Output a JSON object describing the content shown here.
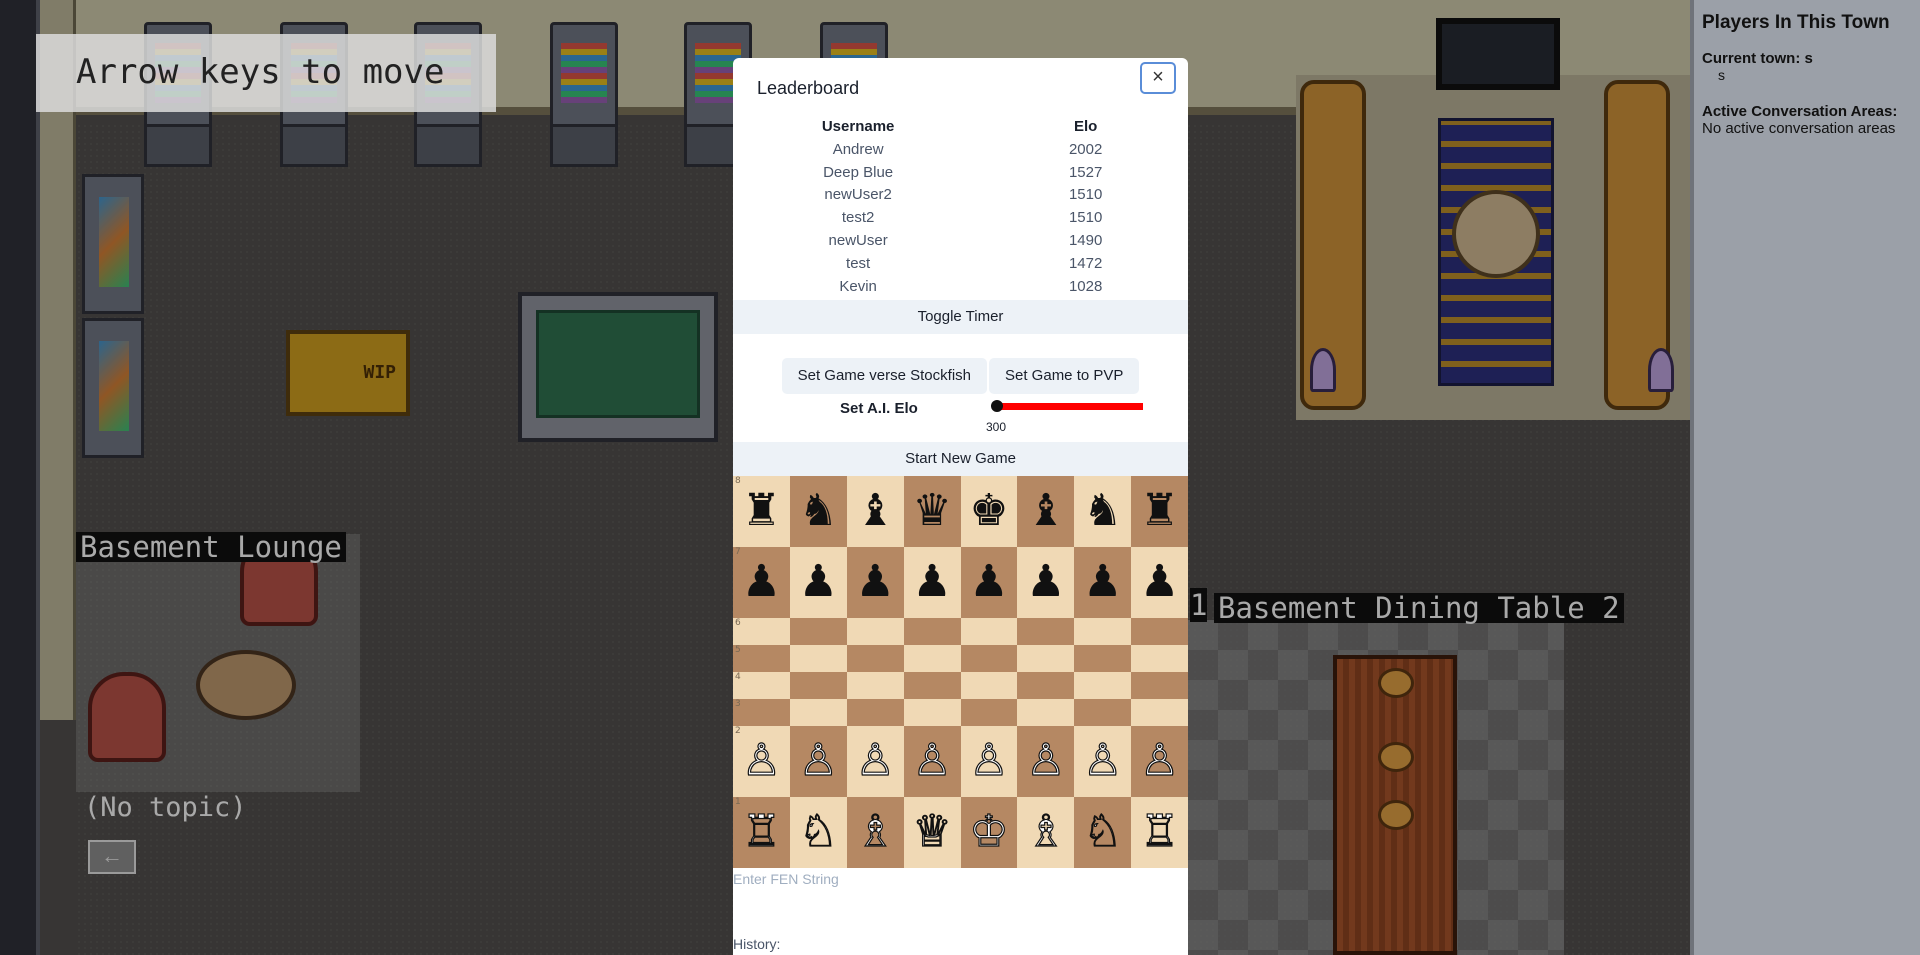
{
  "world": {
    "hint": "Arrow keys to move",
    "lounge_label": "Basement Lounge",
    "lounge_topic": "(No topic)",
    "dining_label_num": "1",
    "dining_label": "Basement Dining Table 2",
    "wip_sign": "WIP"
  },
  "sidebar": {
    "title": "Players In This Town",
    "current_town_label": "Current town: s",
    "player": "s",
    "areas_label": "Active Conversation Areas:",
    "areas_value": "No active conversation areas"
  },
  "modal": {
    "title": "Leaderboard",
    "close": "×",
    "columns": [
      "Username",
      "Elo"
    ],
    "rows": [
      [
        "Andrew",
        "2002"
      ],
      [
        "Deep Blue",
        "1527"
      ],
      [
        "newUser2",
        "1510"
      ],
      [
        "test2",
        "1510"
      ],
      [
        "newUser",
        "1490"
      ],
      [
        "test",
        "1472"
      ],
      [
        "Kevin",
        "1028"
      ]
    ],
    "toggle_timer": "Toggle Timer",
    "stockfish_button": "Set Game verse Stockfish",
    "pvp_button": "Set Game to PVP",
    "elo_label": "Set A.I. Elo",
    "elo_value": 300,
    "elo_value_text": "300",
    "slider_color": "#ff0000",
    "start_button": "Start New Game",
    "fen_placeholder": "Enter FEN String",
    "history_label": "History:",
    "board": [
      [
        "♜",
        "♞",
        "♝",
        "♛",
        "♚",
        "♝",
        "♞",
        "♜"
      ],
      [
        "♟",
        "♟",
        "♟",
        "♟",
        "♟",
        "♟",
        "♟",
        "♟"
      ],
      [
        "",
        "",
        "",
        "",
        "",
        "",
        "",
        ""
      ],
      [
        "",
        "",
        "",
        "",
        "",
        "",
        "",
        ""
      ],
      [
        "",
        "",
        "",
        "",
        "",
        "",
        "",
        ""
      ],
      [
        "",
        "",
        "",
        "",
        "",
        "",
        "",
        ""
      ],
      [
        "♙",
        "♙",
        "♙",
        "♙",
        "♙",
        "♙",
        "♙",
        "♙"
      ],
      [
        "♖",
        "♘",
        "♗",
        "♕",
        "♔",
        "♗",
        "♘",
        "♖"
      ]
    ],
    "rank_labels": [
      "8",
      "7",
      "6",
      "5",
      "4",
      "3",
      "2",
      "1"
    ],
    "light_square": "#f0d9b5",
    "dark_square": "#b58863"
  }
}
